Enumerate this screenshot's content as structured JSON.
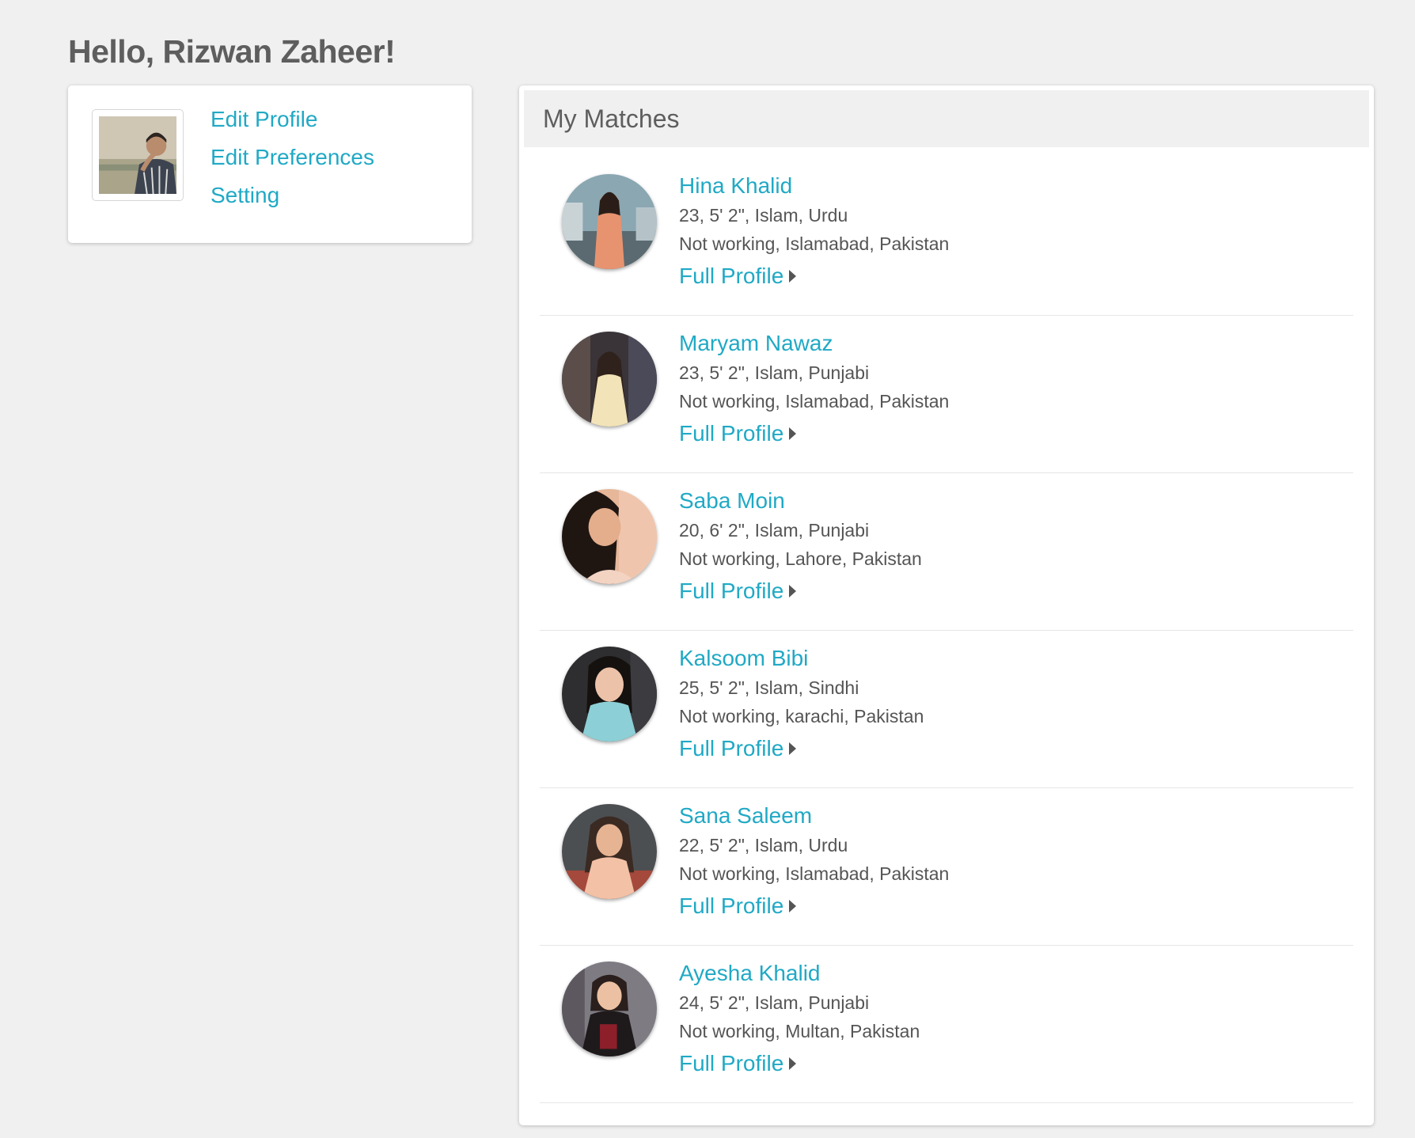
{
  "greeting": "Hello, Rizwan Zaheer!",
  "profile_links": {
    "edit_profile": "Edit Profile",
    "edit_preferences": "Edit Preferences",
    "setting": "Setting"
  },
  "matches": {
    "title": "My Matches",
    "full_profile_label": "Full Profile",
    "items": [
      {
        "name": "Hina Khalid",
        "details": "23, 5' 2\", Islam, Urdu",
        "location": "Not working, Islamabad, Pakistan"
      },
      {
        "name": "Maryam Nawaz",
        "details": "23, 5' 2\", Islam, Punjabi",
        "location": "Not working, Islamabad, Pakistan"
      },
      {
        "name": "Saba Moin",
        "details": "20, 6' 2\", Islam, Punjabi",
        "location": "Not working, Lahore, Pakistan"
      },
      {
        "name": "Kalsoom Bibi",
        "details": "25, 5' 2\", Islam, Sindhi",
        "location": "Not working, karachi, Pakistan"
      },
      {
        "name": "Sana Saleem",
        "details": "22, 5' 2\", Islam, Urdu",
        "location": "Not working, Islamabad, Pakistan"
      },
      {
        "name": "Ayesha Khalid",
        "details": "24, 5' 2\", Islam, Punjabi",
        "location": "Not working, Multan, Pakistan"
      }
    ]
  },
  "colors": {
    "link": "#20a9c5",
    "background": "#f0f0f0",
    "text": "#555555"
  }
}
